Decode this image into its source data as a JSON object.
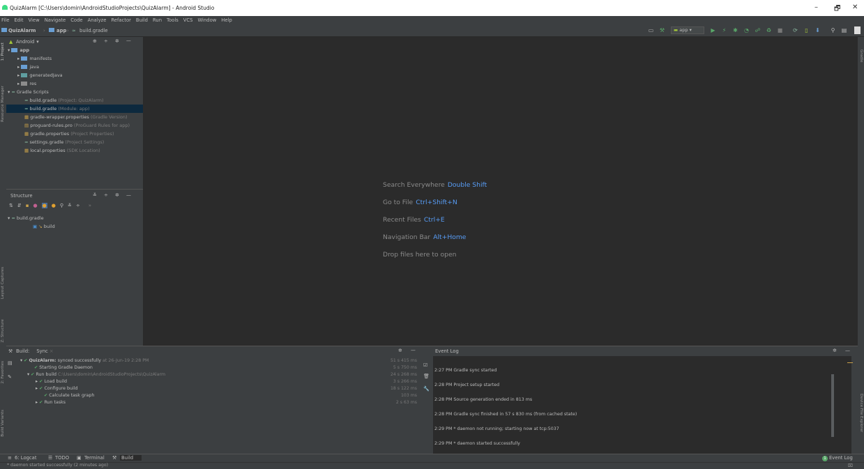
{
  "window": {
    "title": "QuizAlarm [C:\\Users\\domin\\AndroidStudioProjects\\QuizAlarm] - Android Studio",
    "min": "–",
    "max": "🗗",
    "close": "✕"
  },
  "menu": [
    "File",
    "Edit",
    "View",
    "Navigate",
    "Code",
    "Analyze",
    "Refactor",
    "Build",
    "Run",
    "Tools",
    "VCS",
    "Window",
    "Help"
  ],
  "breadcrumb": {
    "project": "QuizAlarm",
    "module": "app",
    "file": "build.gradle"
  },
  "toolbar": {
    "run_config": "app"
  },
  "project": {
    "view": "Android",
    "items": [
      {
        "label": "app",
        "extra": ""
      },
      {
        "label": "manifests",
        "extra": ""
      },
      {
        "label": "java",
        "extra": ""
      },
      {
        "label": "generatedJava",
        "extra": ""
      },
      {
        "label": "res",
        "extra": ""
      },
      {
        "label": "Gradle Scripts",
        "extra": ""
      },
      {
        "label": "build.gradle",
        "extra": "(Project: QuizAlarm)"
      },
      {
        "label": "build.gradle",
        "extra": "(Module: app)"
      },
      {
        "label": "gradle-wrapper.properties",
        "extra": "(Gradle Version)"
      },
      {
        "label": "proguard-rules.pro",
        "extra": "(ProGuard Rules for app)"
      },
      {
        "label": "gradle.properties",
        "extra": "(Project Properties)"
      },
      {
        "label": "settings.gradle",
        "extra": "(Project Settings)"
      },
      {
        "label": "local.properties",
        "extra": "(SDK Location)"
      }
    ]
  },
  "structure": {
    "title": "Structure",
    "root": "build.gradle",
    "child": "build"
  },
  "side_left": {
    "project": "1: Project",
    "resource": "Resource Manager",
    "layout": "Layout Captures",
    "structure": "Z: Structure",
    "favorites": "2: Favorites",
    "variants": "Build Variants"
  },
  "side_right": {
    "gradle": "Gradle",
    "device": "Device File Explorer"
  },
  "editor": {
    "hints": [
      {
        "text": "Search Everywhere",
        "key": "Double Shift"
      },
      {
        "text": "Go to File",
        "key": "Ctrl+Shift+N"
      },
      {
        "text": "Recent Files",
        "key": "Ctrl+E"
      },
      {
        "text": "Navigation Bar",
        "key": "Alt+Home"
      },
      {
        "text": "Drop files here to open",
        "key": ""
      }
    ]
  },
  "build": {
    "tab_label": "Build:",
    "tab": "Sync",
    "rows": [
      {
        "bold": "QuizAlarm:",
        "text": "synced successfully",
        "dim": "at 26-Jun-19 2:28 PM",
        "time": "51 s 415 ms"
      },
      {
        "bold": "",
        "text": "Starting Gradle Daemon",
        "dim": "",
        "time": "5 s 750 ms"
      },
      {
        "bold": "",
        "text": "Run build",
        "dim": "C:\\Users\\domin\\AndroidStudioProjects\\QuizAlarm",
        "time": "24 s 268 ms"
      },
      {
        "bold": "",
        "text": "Load build",
        "dim": "",
        "time": "3 s 266 ms"
      },
      {
        "bold": "",
        "text": "Configure build",
        "dim": "",
        "time": "18 s 122 ms"
      },
      {
        "bold": "",
        "text": "Calculate task graph",
        "dim": "",
        "time": "103 ms"
      },
      {
        "bold": "",
        "text": "Run tasks",
        "dim": "",
        "time": "2 s 63 ms"
      }
    ]
  },
  "eventlog": {
    "title": "Event Log",
    "rows": [
      {
        "time": "2:27 PM",
        "text": "Gradle sync started"
      },
      {
        "time": "2:28 PM",
        "text": "Project setup started"
      },
      {
        "time": "2:28 PM",
        "text": "Source generation ended in 813 ms"
      },
      {
        "time": "2:28 PM",
        "text": "Gradle sync finished in 57 s 830 ms (from cached state)"
      },
      {
        "time": "2:29 PM",
        "text": "* daemon not running; starting now at tcp:5037"
      },
      {
        "time": "2:29 PM",
        "text": "* daemon started successfully"
      }
    ]
  },
  "bottom": {
    "logcat": "6: Logcat",
    "todo": "TODO",
    "terminal": "Terminal",
    "build": "Build",
    "eventlog": "Event Log",
    "eventlog_badge": "1"
  },
  "status": "* daemon started successfully (2 minutes ago)",
  "colors": {
    "bg": "#2b2b2b",
    "panel": "#3c3f41",
    "accent": "#589df6",
    "selection": "#0d293e",
    "green": "#59a869"
  }
}
